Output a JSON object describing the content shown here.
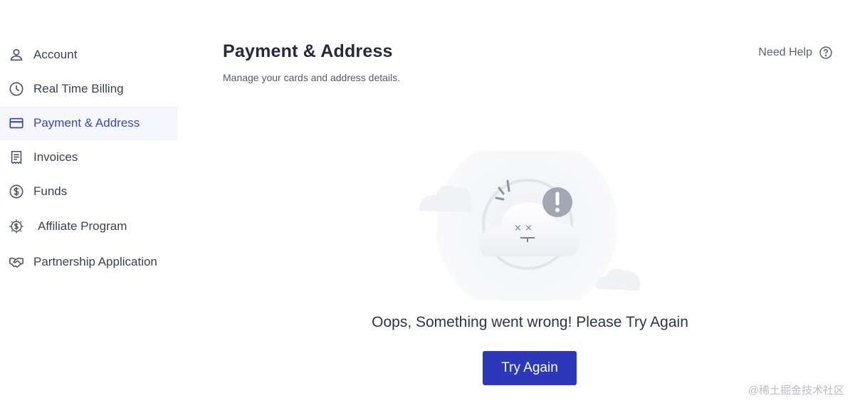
{
  "sidebar": {
    "items": [
      {
        "label": "Account",
        "icon": "user-icon",
        "active": false
      },
      {
        "label": "Real Time Billing",
        "icon": "clock-icon",
        "active": false
      },
      {
        "label": "Payment & Address",
        "icon": "credit-card-icon",
        "active": true
      },
      {
        "label": "Invoices",
        "icon": "invoice-icon",
        "active": false
      },
      {
        "label": "Funds",
        "icon": "dollar-circle-icon",
        "active": false
      },
      {
        "label": "Affiliate Program",
        "icon": "affiliate-dollar-icon",
        "active": false
      },
      {
        "label": "Partnership Application",
        "icon": "handshake-icon",
        "active": false
      }
    ]
  },
  "header": {
    "title": "Payment & Address",
    "subtitle": "Manage your cards and address details.",
    "help_label": "Need Help"
  },
  "error": {
    "message": "Oops, Something went wrong! Please Try Again",
    "button_label": "Try Again"
  },
  "watermark": "@稀土掘金技术社区",
  "colors": {
    "accent": "#2d38b8",
    "active_bg": "#f6f7fc",
    "active_text": "#3b47b5"
  }
}
